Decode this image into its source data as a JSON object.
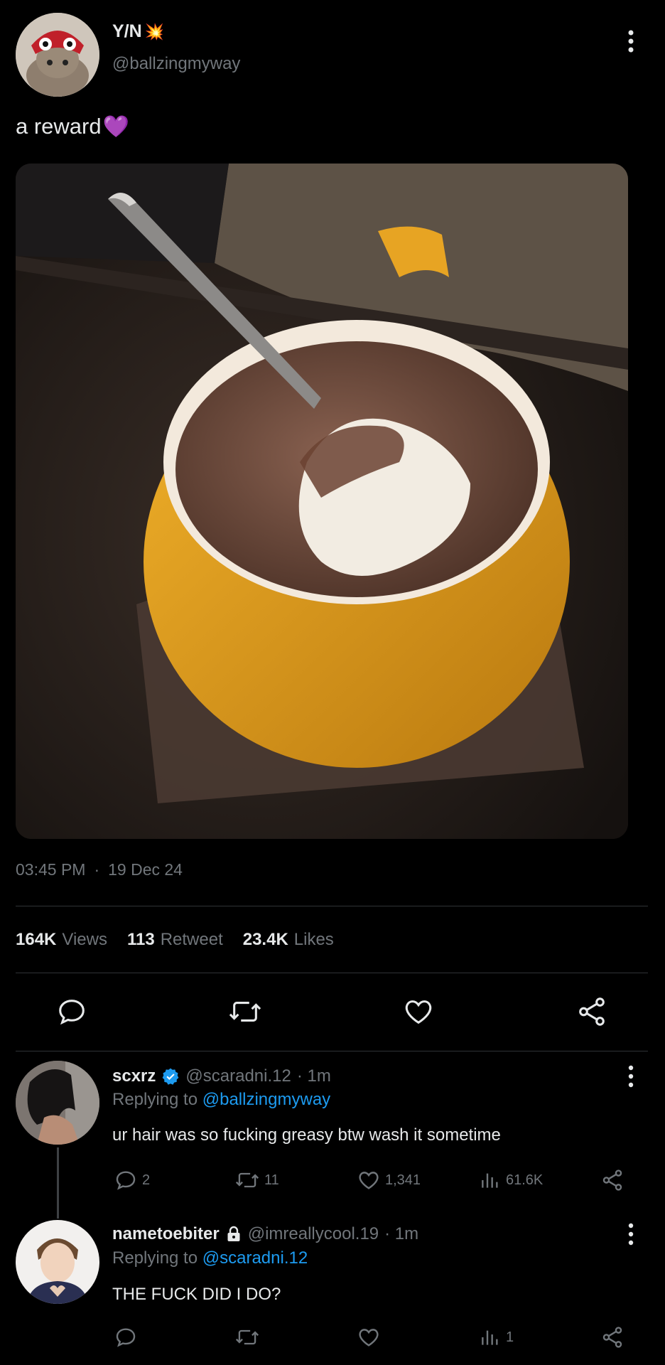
{
  "tweet": {
    "author": {
      "name": "Y/N",
      "name_emoji": "💥",
      "handle": "@ballzingmyway"
    },
    "text": "a reward",
    "text_emoji": "💜",
    "time": "03:45 PM",
    "separator": "·",
    "date": "19 Dec 24",
    "stats": {
      "views_count": "164K",
      "views_label": "Views",
      "retweets_count": "113",
      "retweets_label": "Retweet",
      "likes_count": "23.4K",
      "likes_label": "Likes"
    }
  },
  "replies": [
    {
      "name": "scxrz",
      "handle": "@scaradni.12",
      "time": "· 1m",
      "replying_prefix": "Replying to",
      "replying_to": "@ballzingmyway",
      "text": "ur hair was so fucking greasy btw wash it sometime",
      "replies": "2",
      "retweets": "11",
      "likes": "1,341",
      "views": "61.6K"
    },
    {
      "name": "nametoebiter",
      "handle": "@imreallycool.19",
      "time": "· 1m",
      "replying_prefix": "Replying to",
      "replying_to": "@scaradni.12",
      "text": "THE FUCK DID I DO?",
      "views": "1"
    }
  ],
  "colors": {
    "accent": "#1d9bf0",
    "background": "#000000",
    "text": "#e7e9ea",
    "muted": "#71767b",
    "divider": "#2f3336",
    "mug": "#e8a21c"
  },
  "icons": [
    "more-vertical-icon",
    "reply-icon",
    "retweet-icon",
    "like-icon",
    "share-icon",
    "views-icon",
    "verified-icon",
    "lock-icon"
  ]
}
